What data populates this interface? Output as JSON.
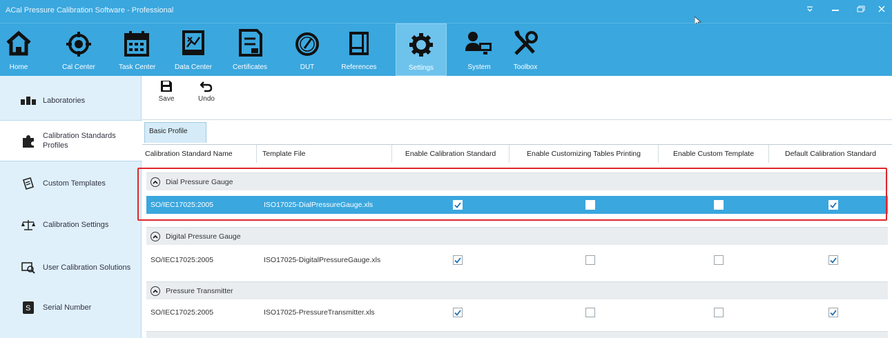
{
  "window": {
    "title": "ACal Pressure Calibration Software - Professional",
    "controls": [
      "pin",
      "minimize",
      "restore",
      "close"
    ]
  },
  "ribbon": {
    "buttons": [
      {
        "label": "Home",
        "icon": "home-icon"
      },
      {
        "label": "Cal Center",
        "icon": "crosshair-icon"
      },
      {
        "label": "Task Center",
        "icon": "calendar-icon"
      },
      {
        "label": "Data Center",
        "icon": "chart-board-icon"
      },
      {
        "label": "Certificates",
        "icon": "certificate-icon"
      },
      {
        "label": "DUT",
        "icon": "gauge-icon"
      },
      {
        "label": "References",
        "icon": "reference-device-icon"
      },
      {
        "label": "Settings",
        "icon": "gear-icon",
        "active": true
      },
      {
        "label": "System",
        "icon": "users-computer-icon"
      },
      {
        "label": "Toolbox",
        "icon": "tools-icon"
      }
    ]
  },
  "sidebar": {
    "items": [
      {
        "label": "Laboratories",
        "icon": "laboratory-icon"
      },
      {
        "label": "Calibration Standards\nProfiles",
        "icon": "puzzle-icon",
        "active": true
      },
      {
        "label": "Custom Templates",
        "icon": "template-icon"
      },
      {
        "label": "Calibration Settings",
        "icon": "scale-icon"
      },
      {
        "label": "User Calibration Solutions",
        "icon": "solutions-icon"
      },
      {
        "label": "Serial Number",
        "icon": "serial-number-icon"
      }
    ]
  },
  "toolbar": {
    "save_label": "Save",
    "undo_label": "Undo"
  },
  "tabs": [
    {
      "label": "Basic Profile",
      "active": true
    }
  ],
  "table": {
    "columns": [
      "Calibration Standard Name",
      "Template File",
      "Enable Calibration Standard",
      "Enable Customizing Tables Printing",
      "Enable Custom Template",
      "Default Calibration Standard"
    ],
    "groups": [
      {
        "name": "Dial Pressure Gauge",
        "rows": [
          {
            "standard": "SO/IEC17025:2005",
            "template": "ISO17025-DialPressureGauge.xls",
            "enable_standard": true,
            "enable_tables_printing": false,
            "enable_custom_template": false,
            "default_standard": true,
            "selected": true
          }
        ]
      },
      {
        "name": "Digital Pressure Gauge",
        "rows": [
          {
            "standard": "SO/IEC17025:2005",
            "template": "ISO17025-DigitalPressureGauge.xls",
            "enable_standard": true,
            "enable_tables_printing": false,
            "enable_custom_template": false,
            "default_standard": true,
            "selected": false
          }
        ]
      },
      {
        "name": "Pressure Transmitter",
        "rows": [
          {
            "standard": "SO/IEC17025:2005",
            "template": "ISO17025-PressureTransmitter.xls",
            "enable_standard": true,
            "enable_tables_printing": false,
            "enable_custom_template": false,
            "default_standard": true,
            "selected": false
          }
        ]
      }
    ]
  },
  "colors": {
    "accent": "#3aa7de",
    "sidebar_bg": "#dff0fa",
    "highlight": "#e0262c"
  }
}
